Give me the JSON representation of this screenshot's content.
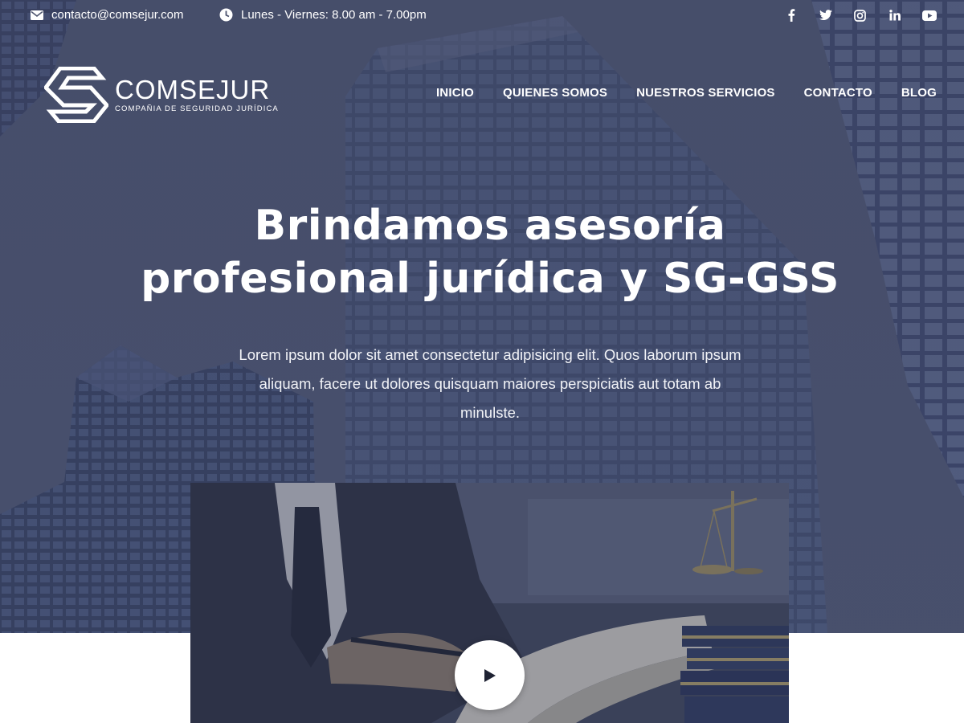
{
  "topbar": {
    "email": "contacto@comsejur.com",
    "email_icon": "envelope-icon",
    "hours": "Lunes - Viernes: 8.00 am - 7.00pm",
    "hours_icon": "clock-icon",
    "socials": [
      "facebook-icon",
      "twitter-icon",
      "instagram-icon",
      "linkedin-icon",
      "youtube-icon"
    ]
  },
  "logo": {
    "brand": "COMSEJUR",
    "tagline": "COMPAÑIA DE SEGURIDAD JURÍDICA"
  },
  "nav": {
    "items": [
      "INICIO",
      "QUIENES SOMOS",
      "NUESTROS SERVICIOS",
      "CONTACTO",
      "BLOG"
    ]
  },
  "hero": {
    "headline_line1": "Brindamos asesoría",
    "headline_line2": "profesional jurídica y SG-GSS",
    "subtitle": "Lorem ipsum dolor sit amet consectetur adipisicing elit. Quos laborum ipsum aliquam, facere ut dolores quisquam maiores perspiciatis aut totam ab minulste."
  },
  "video": {
    "play_icon": "play-icon"
  },
  "colors": {
    "hero_overlay": "#4a5170",
    "text": "#ffffff",
    "background": "#ffffff"
  }
}
